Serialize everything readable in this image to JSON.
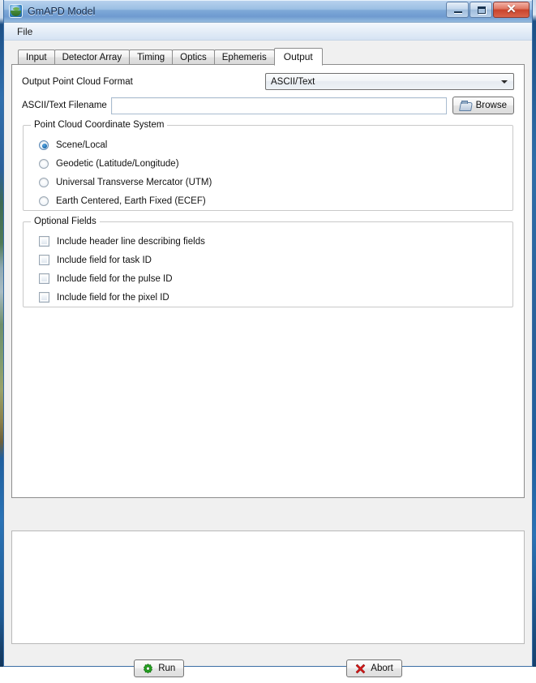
{
  "window": {
    "title": "GmAPD Model",
    "app_icon": "earth-globe-icon",
    "controls": {
      "minimize": "minimize-icon",
      "maximize": "maximize-icon",
      "close": "✕"
    }
  },
  "menubar": {
    "items": [
      {
        "label": "File"
      }
    ]
  },
  "tabs": [
    {
      "label": "Input",
      "active": false
    },
    {
      "label": "Detector Array",
      "active": false
    },
    {
      "label": "Timing",
      "active": false
    },
    {
      "label": "Optics",
      "active": false
    },
    {
      "label": "Ephemeris",
      "active": false
    },
    {
      "label": "Output",
      "active": true
    }
  ],
  "output_tab": {
    "format_row": {
      "label": "Output Point Cloud Format",
      "selected": "ASCII/Text",
      "options": [
        "ASCII/Text"
      ]
    },
    "filename_row": {
      "label": "ASCII/Text Filename",
      "value": "",
      "placeholder": "",
      "browse_button": "Browse",
      "browse_icon": "folder-open-icon"
    },
    "coordinate_system": {
      "title": "Point Cloud Coordinate System",
      "options": [
        {
          "label": "Scene/Local",
          "selected": true
        },
        {
          "label": "Geodetic (Latitude/Longitude)",
          "selected": false
        },
        {
          "label": "Universal Transverse Mercator (UTM)",
          "selected": false
        },
        {
          "label": "Earth Centered, Earth Fixed (ECEF)",
          "selected": false
        }
      ]
    },
    "optional_fields": {
      "title": "Optional Fields",
      "options": [
        {
          "label": "Include header line describing fields",
          "checked": false
        },
        {
          "label": "Include field for task ID",
          "checked": false
        },
        {
          "label": "Include field for the pulse ID",
          "checked": false
        },
        {
          "label": "Include field for the pixel ID",
          "checked": false
        }
      ]
    }
  },
  "log_panel": {
    "content": ""
  },
  "actions": {
    "run": {
      "label": "Run",
      "icon": "green-gear-icon",
      "color": "#22a01f"
    },
    "abort": {
      "label": "Abort",
      "icon": "red-x-icon",
      "color": "#d41a1a"
    }
  }
}
